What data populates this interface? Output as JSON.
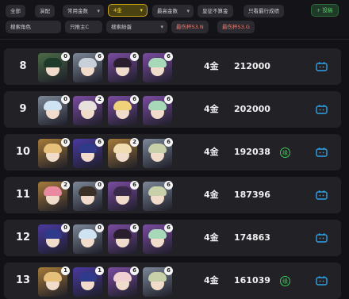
{
  "filters": {
    "row1": [
      "全部",
      "演配",
      "常用金数",
      "4金",
      "最高金数",
      "皇征不算金",
      "只看最行成绩"
    ],
    "row2": [
      "搜索角色",
      "只推主C",
      "搜索紛蛋",
      "最伤杯S3.N",
      "最伤杯S3.G"
    ],
    "upload": "+ 投稿"
  },
  "colors": {
    "accent_gold": "#f2cf3a",
    "badge_green": "#3ccc5a",
    "video_blue": "#2ea3e8"
  },
  "rows": [
    {
      "rank": "8",
      "cost": "4金",
      "score": "212000",
      "badge": "",
      "cons": [
        "0",
        "6",
        "6",
        "6"
      ]
    },
    {
      "rank": "9",
      "cost": "4金",
      "score": "202000",
      "badge": "",
      "cons": [
        "0",
        "2",
        "6",
        "6"
      ]
    },
    {
      "rank": "10",
      "cost": "4金",
      "score": "192038",
      "badge": "缘",
      "cons": [
        "0",
        "6",
        "2",
        "6"
      ]
    },
    {
      "rank": "11",
      "cost": "4金",
      "score": "187396",
      "badge": "",
      "cons": [
        "2",
        "0",
        "6",
        "6"
      ]
    },
    {
      "rank": "12",
      "cost": "4金",
      "score": "174863",
      "badge": "",
      "cons": [
        "0",
        "0",
        "6",
        "6"
      ]
    },
    {
      "rank": "13",
      "cost": "4金",
      "score": "161039",
      "badge": "缘",
      "cons": [
        "1",
        "1",
        "6",
        "6"
      ]
    }
  ]
}
